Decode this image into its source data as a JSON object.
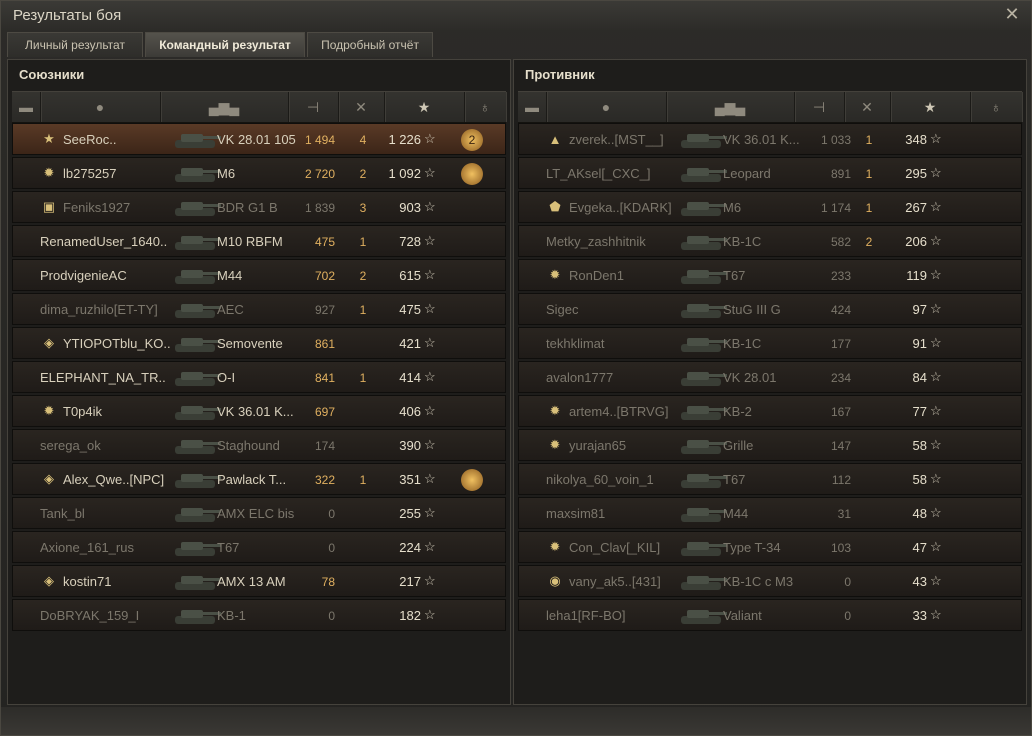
{
  "window": {
    "title": "Результаты боя",
    "close_label": "✕"
  },
  "tabs": [
    {
      "label": "Личный результат",
      "active": false
    },
    {
      "label": "Командный результат",
      "active": true
    },
    {
      "label": "Подробный отчёт",
      "active": false
    }
  ],
  "allies": {
    "title": "Союзники",
    "rows": [
      {
        "name": "SeeRoc..",
        "tank": "VK 28.01 105",
        "damage": "1 494",
        "kills": "4",
        "xp": "1 226",
        "badge": "★",
        "medal": "2",
        "player": true,
        "dead": false
      },
      {
        "name": "lb275257",
        "tank": "M6",
        "damage": "2 720",
        "kills": "2",
        "xp": "1 092",
        "badge": "✹",
        "medal": "",
        "player": false,
        "dead": false
      },
      {
        "name": "Feniks1927",
        "tank": "BDR G1 B",
        "damage": "1 839",
        "kills": "3",
        "xp": "903",
        "badge": "▣",
        "medal": null,
        "player": false,
        "dead": true
      },
      {
        "name": "RenamedUser_1640..",
        "tank": "M10 RBFM",
        "damage": "475",
        "kills": "1",
        "xp": "728",
        "badge": null,
        "medal": null,
        "player": false,
        "dead": false
      },
      {
        "name": "ProdvigenieAC",
        "tank": "M44",
        "damage": "702",
        "kills": "2",
        "xp": "615",
        "badge": null,
        "medal": null,
        "player": false,
        "dead": false
      },
      {
        "name": "dima_ruzhilo[ET-TY]",
        "tank": "AEC",
        "damage": "927",
        "kills": "1",
        "xp": "475",
        "badge": null,
        "medal": null,
        "player": false,
        "dead": true
      },
      {
        "name": "YTIOPOTblu_KO..",
        "tank": "Semovente",
        "damage": "861",
        "kills": "",
        "xp": "421",
        "badge": "◈",
        "medal": null,
        "player": false,
        "dead": false
      },
      {
        "name": "ELEPHANT_NA_TR..",
        "tank": "O-I",
        "damage": "841",
        "kills": "1",
        "xp": "414",
        "badge": null,
        "medal": null,
        "player": false,
        "dead": false
      },
      {
        "name": "T0p4ik",
        "tank": "VK 36.01 K...",
        "damage": "697",
        "kills": "",
        "xp": "406",
        "badge": "✹",
        "medal": null,
        "player": false,
        "dead": false
      },
      {
        "name": "serega_ok",
        "tank": "Staghound",
        "damage": "174",
        "kills": "",
        "xp": "390",
        "badge": null,
        "medal": null,
        "player": false,
        "dead": true
      },
      {
        "name": "Alex_Qwe..[NPC]",
        "tank": "Pawlack T...",
        "damage": "322",
        "kills": "1",
        "xp": "351",
        "badge": "◈",
        "medal": "",
        "player": false,
        "dead": false
      },
      {
        "name": "Tank_bl",
        "tank": "AMX ELC bis",
        "damage": "0",
        "kills": "",
        "xp": "255",
        "badge": null,
        "medal": null,
        "player": false,
        "dead": true
      },
      {
        "name": "Axione_161_rus",
        "tank": "T67",
        "damage": "0",
        "kills": "",
        "xp": "224",
        "badge": null,
        "medal": null,
        "player": false,
        "dead": true
      },
      {
        "name": "kostin71",
        "tank": "AMX 13 AM",
        "damage": "78",
        "kills": "",
        "xp": "217",
        "badge": "◈",
        "medal": null,
        "player": false,
        "dead": false
      },
      {
        "name": "DoBRYAK_159_I",
        "tank": "KB-1",
        "damage": "0",
        "kills": "",
        "xp": "182",
        "badge": null,
        "medal": null,
        "player": false,
        "dead": true
      }
    ]
  },
  "enemies": {
    "title": "Противник",
    "rows": [
      {
        "name": "zverek..[MST__]",
        "tank": "VK 36.01 K...",
        "damage": "1 033",
        "kills": "1",
        "xp": "348",
        "badge": "▲",
        "dead": true
      },
      {
        "name": "LT_AKsel[_CXC_]",
        "tank": "Leopard",
        "damage": "891",
        "kills": "1",
        "xp": "295",
        "badge": null,
        "dead": true
      },
      {
        "name": "Evgeka..[KDARK]",
        "tank": "M6",
        "damage": "1 174",
        "kills": "1",
        "xp": "267",
        "badge": "⬟",
        "dead": true
      },
      {
        "name": "Metky_zashhitnik",
        "tank": "KB-1C",
        "damage": "582",
        "kills": "2",
        "xp": "206",
        "badge": null,
        "dead": true
      },
      {
        "name": "RonDen1",
        "tank": "T67",
        "damage": "233",
        "kills": "",
        "xp": "119",
        "badge": "✹",
        "dead": true
      },
      {
        "name": "Sigec",
        "tank": "StuG III G",
        "damage": "424",
        "kills": "",
        "xp": "97",
        "badge": null,
        "dead": true
      },
      {
        "name": "tekhklimat",
        "tank": "KB-1C",
        "damage": "177",
        "kills": "",
        "xp": "91",
        "badge": null,
        "dead": true
      },
      {
        "name": "avalon1777",
        "tank": "VK 28.01",
        "damage": "234",
        "kills": "",
        "xp": "84",
        "badge": null,
        "dead": true
      },
      {
        "name": "artem4..[BTRVG]",
        "tank": "KB-2",
        "damage": "167",
        "kills": "",
        "xp": "77",
        "badge": "✹",
        "dead": true
      },
      {
        "name": "yurajan65",
        "tank": "Grille",
        "damage": "147",
        "kills": "",
        "xp": "58",
        "badge": "✹",
        "dead": true
      },
      {
        "name": "nikolya_60_voin_1",
        "tank": "T67",
        "damage": "112",
        "kills": "",
        "xp": "58",
        "badge": null,
        "dead": true
      },
      {
        "name": "maxsim81",
        "tank": "M44",
        "damage": "31",
        "kills": "",
        "xp": "48",
        "badge": null,
        "dead": true
      },
      {
        "name": "Con_Clav[_KIL]",
        "tank": "Type T-34",
        "damage": "103",
        "kills": "",
        "xp": "47",
        "badge": "✹",
        "dead": true
      },
      {
        "name": "vany_ak5..[431]",
        "tank": "KB-1C c M3",
        "damage": "0",
        "kills": "",
        "xp": "43",
        "badge": "◉",
        "dead": true
      },
      {
        "name": "leha1[RF-BO]",
        "tank": "Valiant",
        "damage": "0",
        "kills": "",
        "xp": "33",
        "badge": null,
        "dead": true
      }
    ]
  },
  "icons": {
    "star": "★",
    "star_outline": "☆",
    "sort_arrow": "⌄"
  }
}
